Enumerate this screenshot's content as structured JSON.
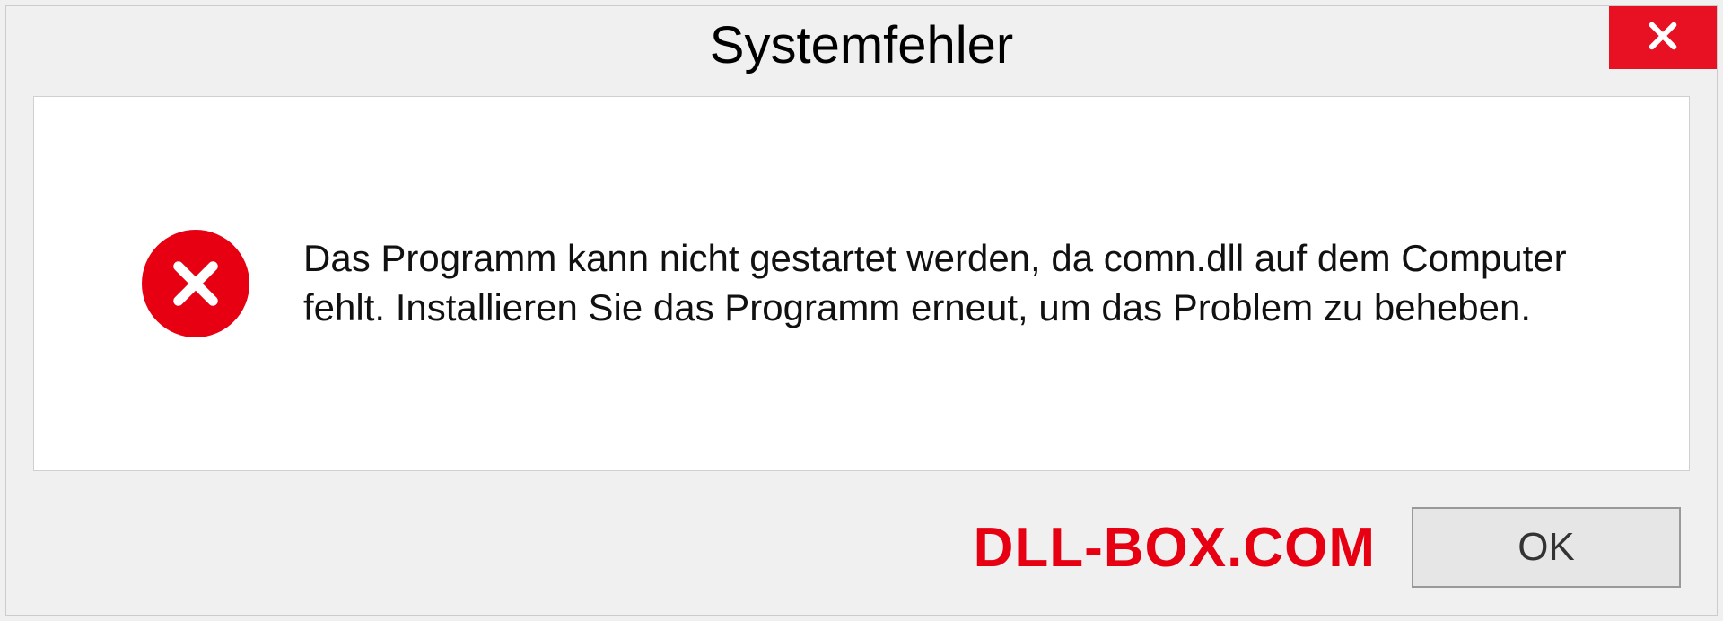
{
  "dialog": {
    "title": "Systemfehler",
    "message": "Das Programm kann nicht gestartet werden, da comn.dll auf dem Computer fehlt. Installieren Sie das Programm erneut, um das Problem zu beheben.",
    "ok_label": "OK"
  },
  "watermark": "DLL-BOX.COM"
}
